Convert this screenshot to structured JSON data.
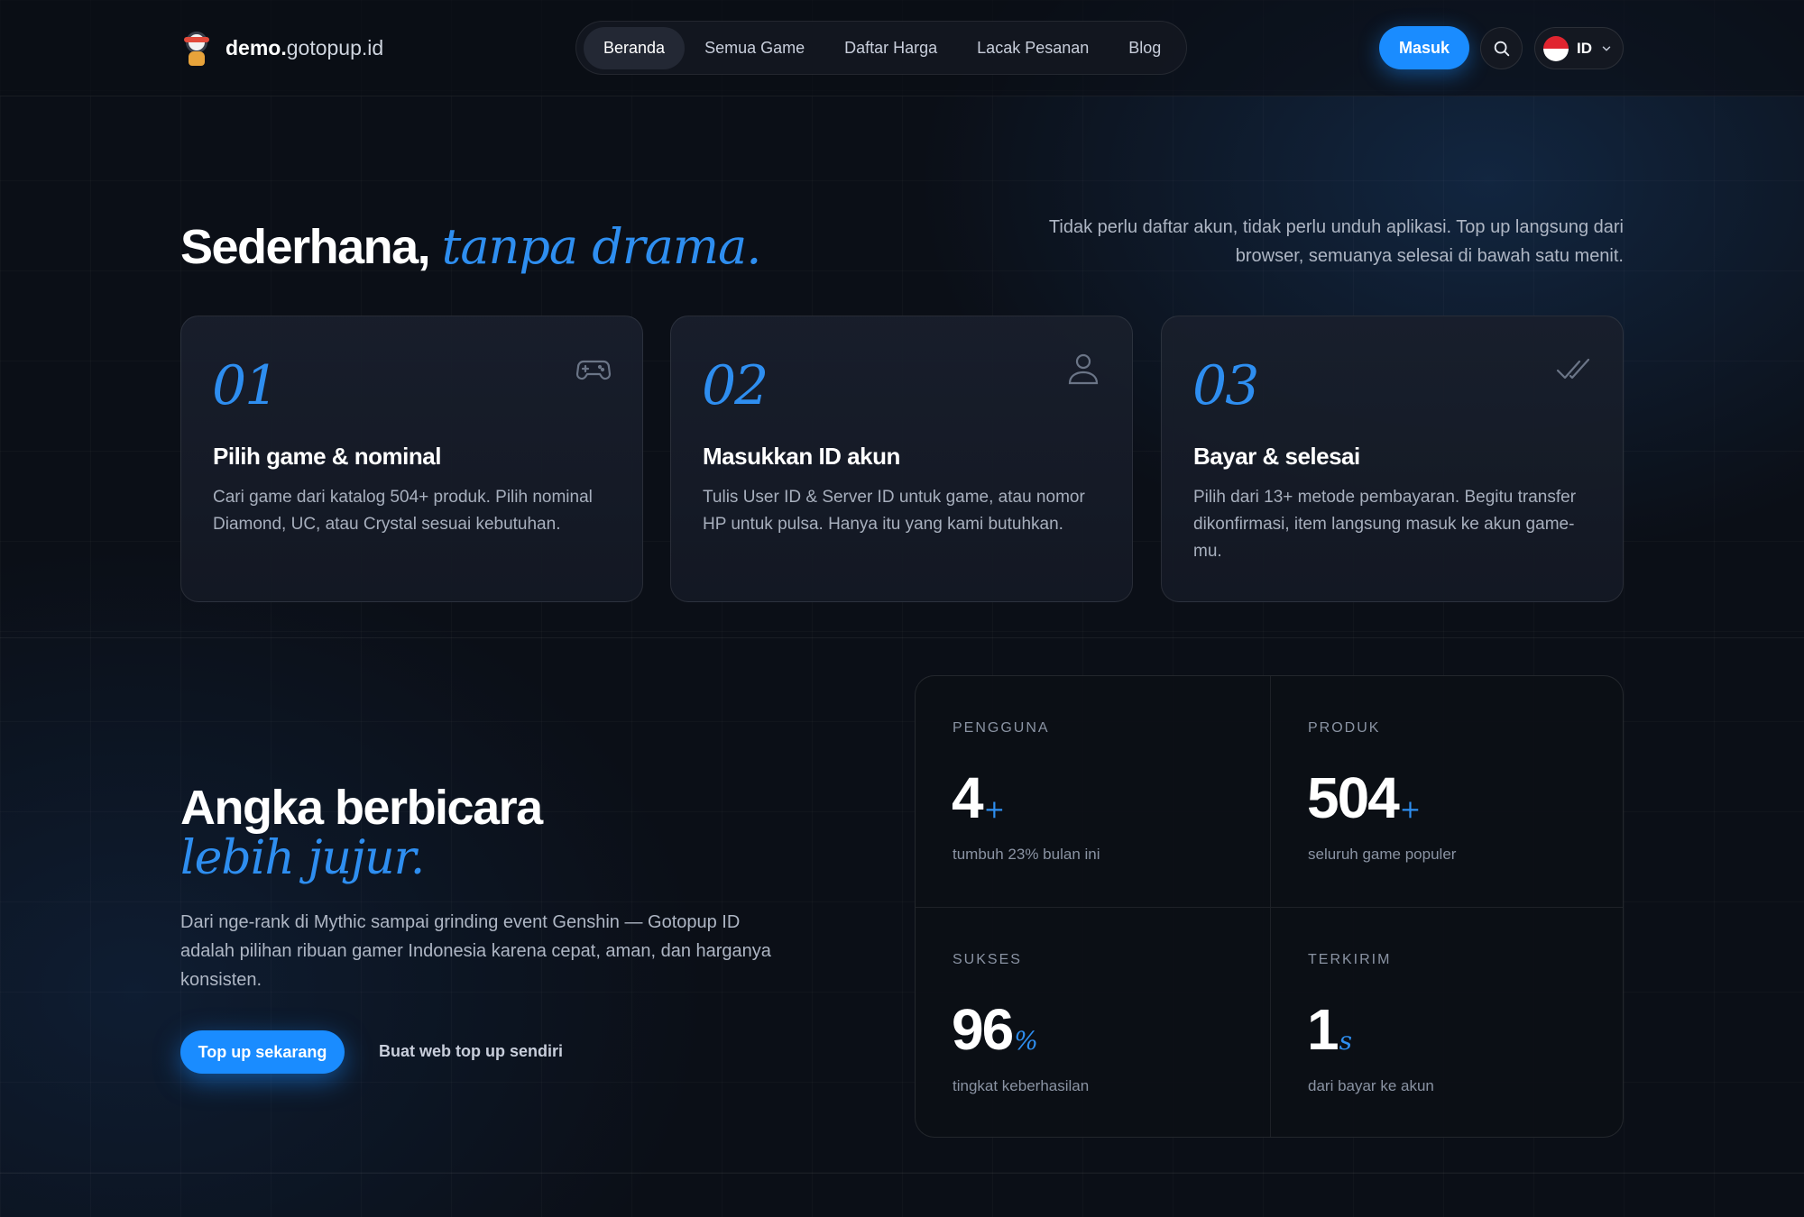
{
  "brand": {
    "bold": "demo.",
    "rest": "gotopup.id"
  },
  "nav": {
    "links": [
      "Beranda",
      "Semua Game",
      "Daftar Harga",
      "Lacak Pesanan",
      "Blog"
    ],
    "login": "Masuk",
    "language": "ID"
  },
  "how": {
    "title": "Sederhana,",
    "title_accent": "tanpa drama.",
    "intro": "Tidak perlu daftar akun, tidak perlu unduh aplikasi. Top up langsung dari browser, semuanya selesai di bawah satu menit.",
    "steps": [
      {
        "num": "01",
        "title": "Pilih game & nominal",
        "desc": "Cari game dari katalog 504+ produk. Pilih nominal Diamond, UC, atau Crystal sesuai kebutuhan.",
        "icon": "gamepad-icon"
      },
      {
        "num": "02",
        "title": "Masukkan ID akun",
        "desc": "Tulis User ID & Server ID untuk game, atau nomor HP untuk pulsa. Hanya itu yang kami butuhkan.",
        "icon": "user-icon"
      },
      {
        "num": "03",
        "title": "Bayar & selesai",
        "desc": "Pilih dari 13+ metode pembayaran. Begitu transfer dikonfirmasi, item langsung masuk ke akun game-mu.",
        "icon": "double-check-icon"
      }
    ]
  },
  "stats_section": {
    "title": "Angka berbicara",
    "title_accent": "lebih jujur.",
    "paragraph": "Dari nge-rank di Mythic sampai grinding event Genshin — Gotopup ID adalah pilihan ribuan gamer Indonesia karena cepat, aman, dan harganya konsisten.",
    "cta_primary": "Top up sekarang",
    "cta_secondary": "Buat web top up sendiri",
    "stats": [
      {
        "label": "PENGGUNA",
        "value": "4",
        "unit": "+",
        "sub": "tumbuh 23% bulan ini"
      },
      {
        "label": "PRODUK",
        "value": "504",
        "unit": "+",
        "sub": "seluruh game populer"
      },
      {
        "label": "SUKSES",
        "value": "96",
        "unit": "%",
        "sub": "tingkat keberhasilan"
      },
      {
        "label": "TERKIRIM",
        "value": "1",
        "unit": "s",
        "sub": "dari bayar ke akun"
      }
    ]
  },
  "colors": {
    "accent": "#1a8cff",
    "accent_text": "#2e8ef0",
    "background": "#0b0f17"
  }
}
